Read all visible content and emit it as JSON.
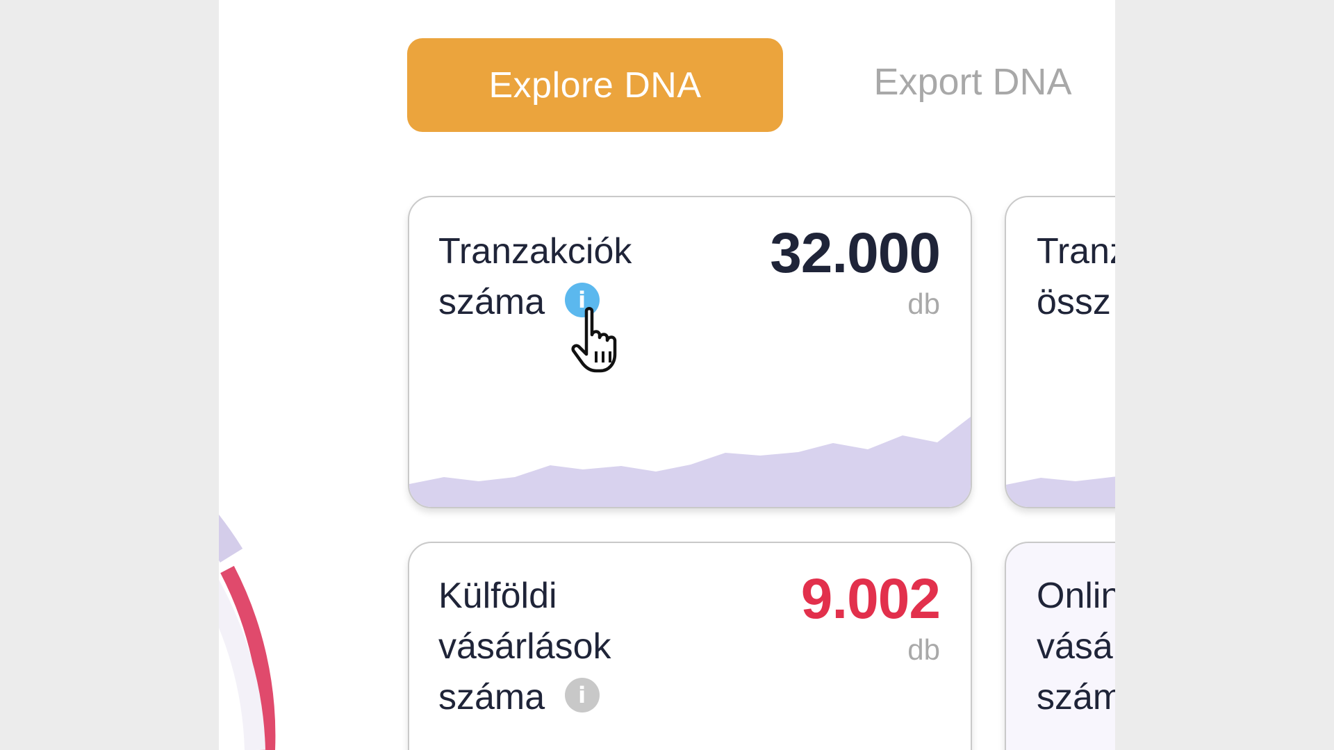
{
  "tabs": {
    "explore_label": "Explore DNA",
    "export_label": "Export DNA"
  },
  "cards": [
    {
      "title_lines": [
        "Tranzakciók",
        "száma"
      ],
      "value": "32.000",
      "unit": "db",
      "value_color": "#1f2438",
      "info_icon": "info-icon-highlighted"
    },
    {
      "title_lines": [
        "Tranz",
        "össz"
      ]
    },
    {
      "title_lines": [
        "Külföldi",
        "vásárlások",
        "száma"
      ],
      "value": "9.002",
      "unit": "db",
      "value_color": "#e2304c",
      "info_icon": "info-icon"
    },
    {
      "title_lines": [
        "Onlin",
        "vásá",
        "szám"
      ]
    }
  ],
  "colors": {
    "accent": "#eba43d",
    "sparkline_fill": "#d8d2ee",
    "gauge_red": "#e04a6c",
    "gauge_lavender": "#d4cdea"
  },
  "icons": {
    "info": "i",
    "cursor": "hand-pointer-icon"
  }
}
